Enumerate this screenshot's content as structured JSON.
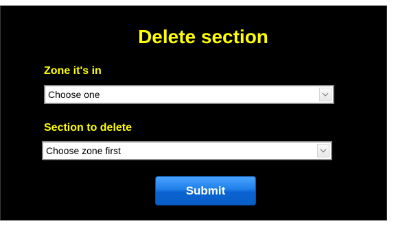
{
  "form": {
    "title": "Delete section",
    "zone_label": "Zone it's in",
    "zone_select_value": "Choose one",
    "section_label": "Section to delete",
    "section_select_value": "Choose zone first",
    "submit_label": "Submit"
  },
  "colors": {
    "panel_background": "#000000",
    "label_text": "#ffff00",
    "button": "#1f7fe8",
    "button_text": "#ffffff"
  },
  "icons": {
    "dropdown": "chevron-down-icon"
  }
}
